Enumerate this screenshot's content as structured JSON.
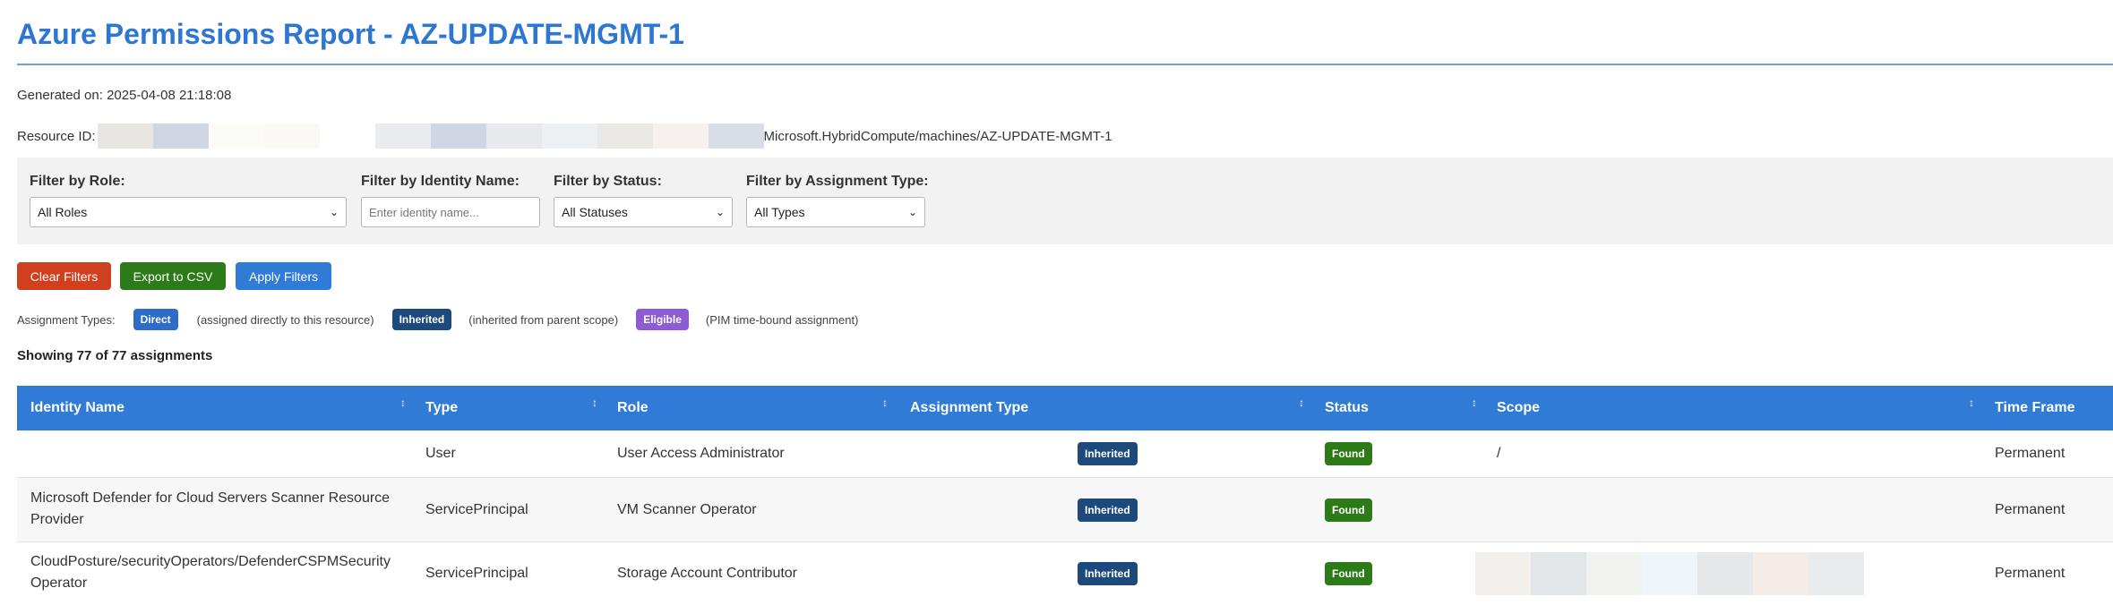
{
  "page": {
    "title": "Azure Permissions Report - AZ-UPDATE-MGMT-1",
    "generated": "Generated on: 2025-04-08 21:18:08",
    "resource_label": "Resource ID:",
    "resource_suffix": "Microsoft.HybridCompute/machines/AZ-UPDATE-MGMT-1"
  },
  "filters": {
    "role": {
      "label": "Filter by Role:",
      "value": "All Roles"
    },
    "identity": {
      "label": "Filter by Identity Name:",
      "placeholder": "Enter identity name..."
    },
    "status": {
      "label": "Filter by Status:",
      "value": "All Statuses"
    },
    "assignment_type": {
      "label": "Filter by Assignment Type:",
      "value": "All Types"
    }
  },
  "buttons": {
    "clear": "Clear Filters",
    "export": "Export to CSV",
    "apply": "Apply Filters"
  },
  "legend": {
    "label": "Assignment Types:",
    "direct": "Direct",
    "direct_desc": "(assigned directly to this resource)",
    "inherited": "Inherited",
    "inherited_desc": "(inherited from parent scope)",
    "eligible": "Eligible",
    "eligible_desc": "(PIM time-bound assignment)"
  },
  "summary": "Showing 77 of 77 assignments",
  "table": {
    "columns": [
      "Identity Name",
      "Type",
      "Role",
      "Assignment Type",
      "Status",
      "Scope",
      "Time Frame"
    ],
    "rows": [
      {
        "identity": "",
        "type": "User",
        "role": "User Access Administrator",
        "assignment": "Inherited",
        "status": "Found",
        "scope": "/",
        "time": "Permanent"
      },
      {
        "identity": "Microsoft Defender for Cloud Servers Scanner Resource Provider",
        "type": "ServicePrincipal",
        "role": "VM Scanner Operator",
        "assignment": "Inherited",
        "status": "Found",
        "scope": "",
        "time": "Permanent"
      },
      {
        "identity": "CloudPosture/securityOperators/DefenderCSPMSecurityOperator",
        "type": "ServicePrincipal",
        "role": "Storage Account Contributor",
        "assignment": "Inherited",
        "status": "Found",
        "scope": "",
        "time": "Permanent"
      }
    ]
  },
  "colors": {
    "title": "#2d76d2",
    "header": "#2f7bd6",
    "clear_button": "#d0401f",
    "export_button": "#2c7b18",
    "apply_button": "#2f7bd6",
    "direct": "#2d6cc8",
    "inherited": "#1d4a7d",
    "eligible": "#8e5bd4",
    "found": "#2c7b18"
  },
  "icons": {
    "sort": "sort-arrows-icon",
    "dropdown": "chevron-down-icon"
  }
}
